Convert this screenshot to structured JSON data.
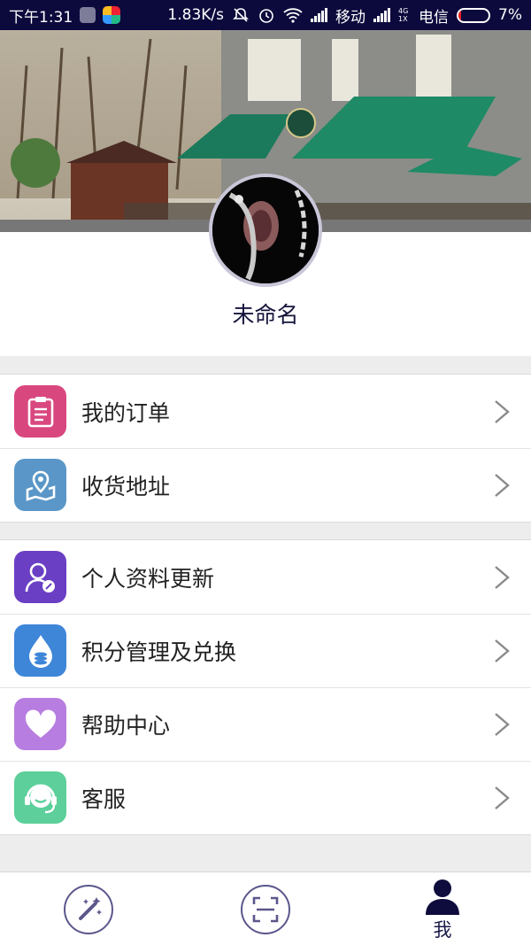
{
  "status_bar": {
    "time": "下午1:31",
    "speed": "1.83K/s",
    "carrier1": "移动",
    "carrier2": "电信",
    "network_tag": "4G 1X",
    "battery": "7%",
    "battery_level": 0.07,
    "icons": [
      "app-icon",
      "app-icon",
      "mute-icon",
      "alarm-icon",
      "wifi-icon",
      "signal-icon",
      "signal-icon",
      "battery-icon"
    ]
  },
  "profile": {
    "name": "未命名",
    "avatar_icon": "avatar-photo"
  },
  "menu_groups": [
    {
      "items": [
        {
          "label": "我的订单",
          "icon": "order-list-icon",
          "color": "#d9477f"
        },
        {
          "label": "收货地址",
          "icon": "map-pin-icon",
          "color": "#5a97c8"
        }
      ]
    },
    {
      "items": [
        {
          "label": "个人资料更新",
          "icon": "user-edit-icon",
          "color": "#6a3fc4"
        },
        {
          "label": "积分管理及兑换",
          "icon": "points-drop-icon",
          "color": "#3e86d8"
        },
        {
          "label": "帮助中心",
          "icon": "heart-icon",
          "color": "#b77de0"
        },
        {
          "label": "客服",
          "icon": "headset-icon",
          "color": "#5ccf9a"
        }
      ]
    }
  ],
  "tab_bar": {
    "tabs": [
      {
        "icon": "magic-wand-icon",
        "label": ""
      },
      {
        "icon": "scan-icon",
        "label": ""
      },
      {
        "icon": "person-icon",
        "label": "我",
        "active": true
      }
    ]
  },
  "colors": {
    "status_bar": "#0c0a3c",
    "accent": "#14143c",
    "chevron": "#888888"
  }
}
